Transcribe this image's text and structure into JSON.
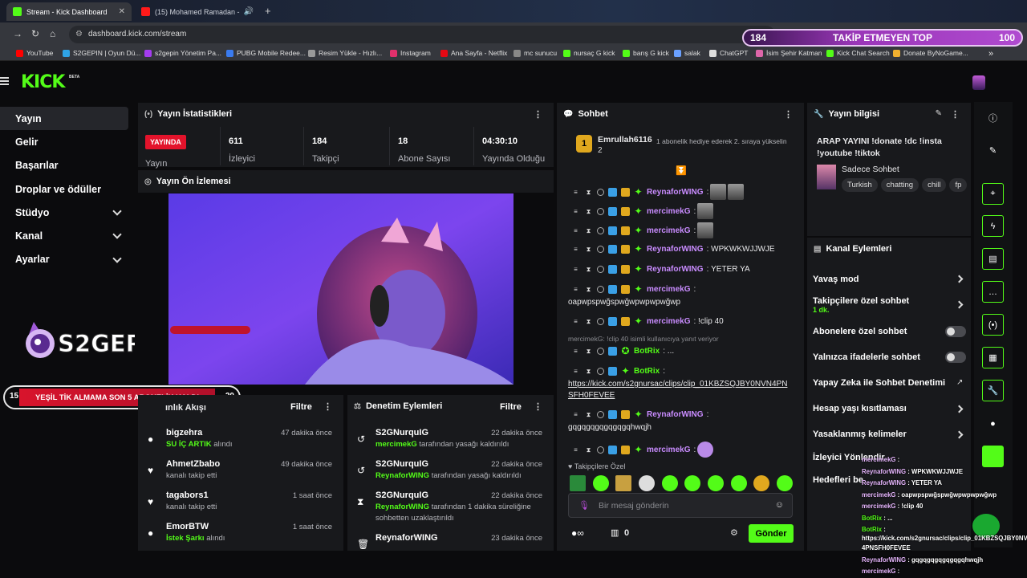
{
  "browser": {
    "tabs": [
      {
        "title": "Stream - Kick Dashboard",
        "active": true
      },
      {
        "title": "(15) Mohamed Ramadan -",
        "active": false
      }
    ],
    "url": "dashboard.kick.com/stream",
    "bookmarks": [
      "YouTube",
      "S2GEPIN | Oyun Dü...",
      "s2gepin Yönetim Pa...",
      "PUBG Mobile Redee...",
      "Resim Yükle - Hızlı...",
      "Instagram",
      "Ana Sayfa - Netflix",
      "mc sunucu",
      "nursaç G kick",
      "barış G kick",
      "salak",
      "ChatGPT",
      "İsim Şehir Katman",
      "Kick Chat Search",
      "Donate ByNoGame..."
    ]
  },
  "overlay_top": {
    "left": "184",
    "title": "TAKİP ETMEYEN TOP",
    "right": "100"
  },
  "header": {
    "logo": "KICK",
    "beta": "BETA"
  },
  "sidebar": {
    "items": [
      {
        "label": "Yayın",
        "active": true,
        "chevron": false
      },
      {
        "label": "Gelir",
        "chevron": false
      },
      {
        "label": "Başarılar",
        "chevron": false
      },
      {
        "label": "Droplar ve ödüller",
        "chevron": false
      },
      {
        "label": "Stüdyo",
        "chevron": true
      },
      {
        "label": "Kanal",
        "chevron": true
      },
      {
        "label": "Ayarlar",
        "chevron": true
      }
    ],
    "brand": "S2GEPIN"
  },
  "stats": {
    "title": "Yayın İstatistikleri",
    "live_label": "YAYINDA",
    "status_label": "Yayın",
    "viewers": {
      "value": "611",
      "label": "İzleyici"
    },
    "followers": {
      "value": "184",
      "label": "Takipçi"
    },
    "subs": {
      "value": "18",
      "label": "Abone Sayısı"
    },
    "uptime": {
      "value": "04:30:10",
      "label": "Yayında Olduğu"
    }
  },
  "preview": {
    "title": "Yayın Ön İzlemesi",
    "overlay_text": "YEŞİL TİK ALMAMA SON 5 ABONELİK KALDI"
  },
  "banner": {
    "left": "15",
    "text": "YEŞİL TİK ALMAMA SON 5 ABONELİK KALDI",
    "right": "20"
  },
  "activity": {
    "title": "Etkinlik Akışı",
    "title_visible": "ınlık Akışı",
    "filter": "Filtre",
    "rows": [
      {
        "name": "bigzehra",
        "time": "47 dakika önce",
        "hl": "SU İÇ ARTIK",
        "desc": "alındı"
      },
      {
        "name": "AhmetZbabo",
        "time": "49 dakika önce",
        "hl": "",
        "desc": "kanalı takip etti"
      },
      {
        "name": "tagabors1",
        "time": "1 saat önce",
        "hl": "",
        "desc": "kanalı takip etti"
      },
      {
        "name": "EmorBTW",
        "time": "1 saat önce",
        "hl": "İstek Şarkı",
        "desc": "alındı"
      }
    ]
  },
  "moderation": {
    "title": "Denetim Eylemleri",
    "filter": "Filtre",
    "rows": [
      {
        "name": "S2GNurquIG",
        "time": "22 dakika önce",
        "hl": "mercimekG",
        "desc": "tarafından yasağı kaldırıldı"
      },
      {
        "name": "S2GNurquIG",
        "time": "22 dakika önce",
        "hl": "ReynaforWING",
        "desc": "tarafından yasağı kaldırıldı"
      },
      {
        "name": "S2GNurquIG",
        "time": "22 dakika önce",
        "hl": "ReynaforWING",
        "desc": "tarafından 1 dakika süreliğine",
        "desc2": "sohbetten uzaklaştırıldı"
      },
      {
        "name": "ReynaforWING",
        "time": "23 dakika önce",
        "hl": "",
        "desc": ""
      }
    ]
  },
  "chat": {
    "title": "Sohbet",
    "pinned_user": "Emrullah6116",
    "pinned_rank": "1",
    "pinned_count": "2",
    "pinned_text": "1 abonelik hediye ederek 2. sıraya yükselin",
    "messages": [
      {
        "user": "ReynaforWING",
        "color": "#c98cff",
        "text": ""
      },
      {
        "user": "mercimekG",
        "color": "#c98cff",
        "text": ""
      },
      {
        "user": "mercimekG",
        "color": "#c98cff",
        "text": ""
      },
      {
        "user": "ReynaforWING",
        "color": "#c98cff",
        "text": "WPKWKWJJWJE"
      },
      {
        "user": "ReynaforWING",
        "color": "#c98cff",
        "text": "YETER YA"
      },
      {
        "user": "mercimekG",
        "color": "#c98cff",
        "text": "",
        "text2": "oapwpspwğspwğwpwpwpwğwp"
      },
      {
        "user": "mercimekG",
        "color": "#c98cff",
        "text": "!clip 40"
      },
      {
        "reply": "mercimekG: !clip 40 isimli kullanıcıya yanıt veriyor",
        "user": "BotRix",
        "color": "#53fc18",
        "text": "..."
      },
      {
        "user": "BotRix",
        "color": "#53fc18",
        "text": "",
        "text2": "https://kick.com/s2gnursac/clips/clip_01KBZSQJBY0NVN4PN",
        "text3": "SFH0FEVEE"
      },
      {
        "user": "ReynaforWING",
        "color": "#c98cff",
        "text": "",
        "text2": "gqgqgqgqgqgqgqhwqjh"
      },
      {
        "user": "mercimekG",
        "color": "#c98cff",
        "text": ""
      }
    ],
    "followers_only": "Takipçilere Özel",
    "placeholder": "Bir mesaj gönderin",
    "points": "0",
    "send": "Gönder"
  },
  "stream_info": {
    "title": "Yayın bilgisi",
    "stream_title": "ARAP YAYINI !donate !dc !insta !youtube !tiktok",
    "category": "Sadece Sohbet",
    "tags": [
      "Turkish",
      "chatting",
      "chill",
      "fp"
    ]
  },
  "channel_actions": {
    "title": "Kanal Eylemleri",
    "items": [
      {
        "label": "Yavaş mod",
        "type": "chevron"
      },
      {
        "label": "Takipçilere özel sohbet",
        "sub": "1 dk.",
        "type": "chevron"
      },
      {
        "label": "Abonelere özel sohbet",
        "type": "toggle"
      },
      {
        "label": "Yalnızca ifadelerle sohbet",
        "type": "toggle"
      },
      {
        "label": "Yapay Zeka ile Sohbet Denetimi",
        "type": "external"
      },
      {
        "label": "Hesap yaşı kısıtlaması",
        "type": "chevron"
      },
      {
        "label": "Yasaklanmış kelimeler",
        "type": "chevron"
      },
      {
        "label": "İzleyici Yönlendir",
        "type": "none"
      },
      {
        "label": "Hedefleri be",
        "type": "none"
      }
    ]
  },
  "overlay_chat": [
    {
      "user": "mercimekG",
      "text": ""
    },
    {
      "user": "ReynaforWING",
      "text": "WPKWKWJJWJE"
    },
    {
      "user": "ReynaforWING",
      "text": "YETER YA"
    },
    {
      "user": "mercimekG",
      "text": "oapwpspwğspwğwpwpwpwğwp"
    },
    {
      "user": "mercimekG",
      "text": "!clip 40"
    },
    {
      "user": "BotRix",
      "text": "..."
    },
    {
      "user": "BotRix",
      "text": "https://kick.com/s2gnursac/clips/clip_01KBZSQJBY0NVN",
      "text2": "4PNSFH0FEVEE"
    },
    {
      "user": "ReynaforWING",
      "text": "gqgqgqgqgqgqgqhwqjh"
    },
    {
      "user": "mercimekG",
      "text": ""
    }
  ],
  "colors": {
    "accent": "#53fc18",
    "live": "#e3132b",
    "panel": "#18191c"
  }
}
